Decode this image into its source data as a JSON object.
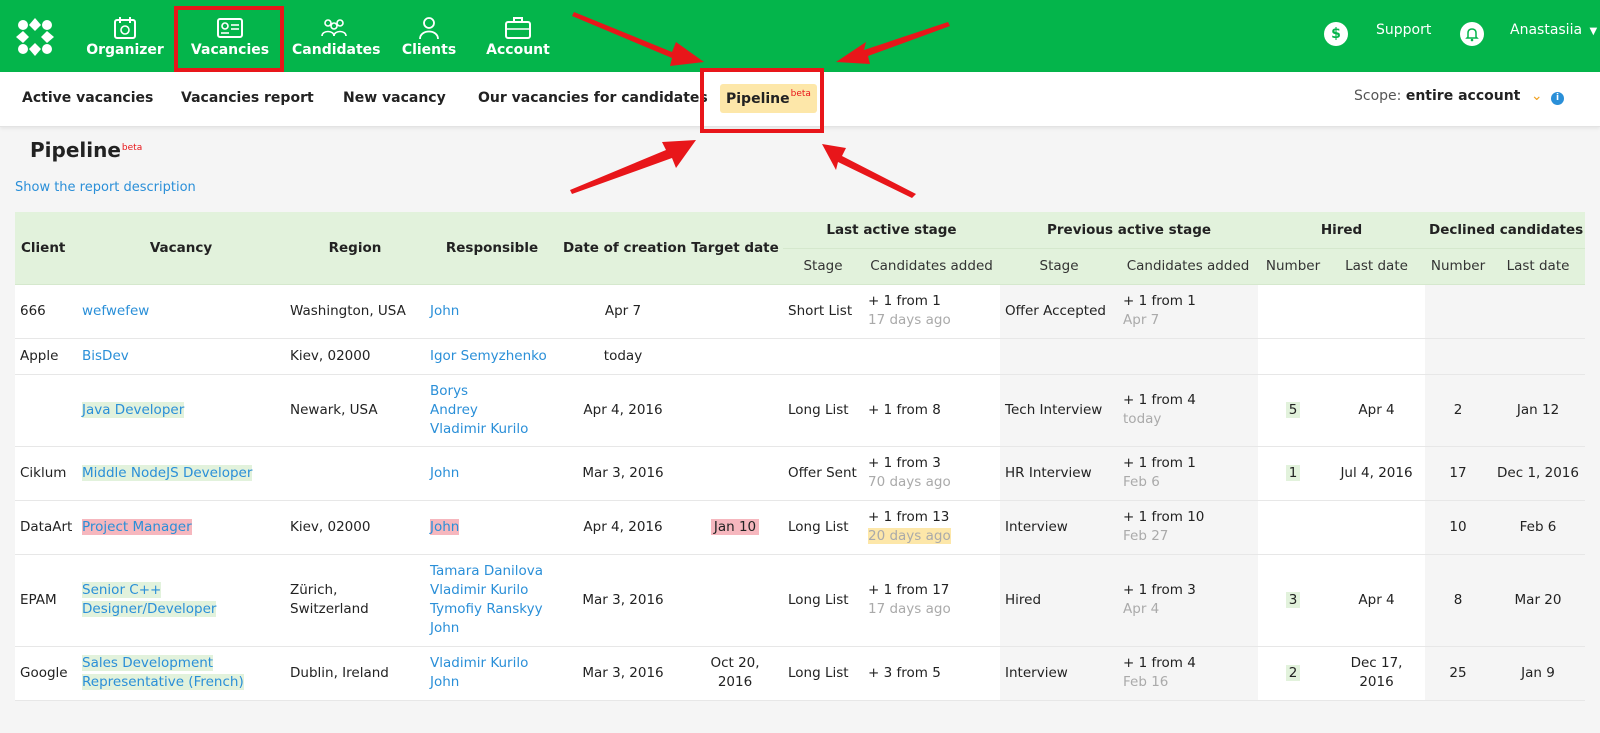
{
  "topnav": {
    "items": [
      {
        "label": "Organizer",
        "icon": "organizer-icon"
      },
      {
        "label": "Vacancies",
        "icon": "vacancy-card-icon"
      },
      {
        "label": "Candidates",
        "icon": "people-icon"
      },
      {
        "label": "Clients",
        "icon": "person-icon"
      },
      {
        "label": "Account",
        "icon": "briefcase-icon"
      }
    ],
    "dollar_glyph": "$",
    "support": "Support",
    "user": "Anastasiia"
  },
  "subnav": {
    "items": [
      "Active vacancies",
      "Vacancies report",
      "New vacancy",
      "Our vacancies for candidates"
    ],
    "pipeline": "Pipeline",
    "beta": "beta",
    "scope_label": "Scope:",
    "scope_value": "entire account"
  },
  "page": {
    "title": "Pipeline",
    "beta": "beta",
    "description_link": "Show the report description"
  },
  "table": {
    "headers": {
      "client": "Client",
      "vacancy": "Vacancy",
      "region": "Region",
      "responsible": "Responsible",
      "date_of_creation": "Date of creation",
      "target_date": "Target date",
      "last_active_stage": "Last active stage",
      "previous_active_stage": "Previous active stage",
      "hired": "Hired",
      "declined": "Declined candidates",
      "stage": "Stage",
      "candidates_added": "Candidates added",
      "number": "Number",
      "last_date": "Last date"
    },
    "rows": [
      {
        "client": "666",
        "vacancy": "wefwefew",
        "region": "Washington, USA",
        "responsible": [
          "John"
        ],
        "created": "Apr 7",
        "target": "",
        "last_stage": "Short List",
        "last_added": "+ 1 from 1",
        "last_ago": "17 days ago",
        "prev_stage": "Offer Accepted",
        "prev_added": "+ 1 from 1",
        "prev_ago": "Apr 7",
        "hired_num": "",
        "hired_date": "",
        "declined_num": "",
        "declined_date": ""
      },
      {
        "client": "Apple",
        "vacancy": "BisDev",
        "region": "Kiev, 02000",
        "responsible": [
          "Igor Semyzhenko"
        ],
        "created": "today",
        "target": "",
        "last_stage": "",
        "last_added": "",
        "last_ago": "",
        "prev_stage": "",
        "prev_added": "",
        "prev_ago": "",
        "hired_num": "",
        "hired_date": "",
        "declined_num": "",
        "declined_date": ""
      },
      {
        "client": "",
        "vacancy": "Java Developer",
        "region": "Newark, USA",
        "responsible": [
          "Borys",
          "Andrey",
          "Vladimir Kurilo"
        ],
        "created": "Apr 4, 2016",
        "target": "",
        "last_stage": "Long List",
        "last_added": "+ 1 from 8",
        "last_ago": "",
        "prev_stage": "Tech Interview",
        "prev_added": "+ 1 from 4",
        "prev_ago": "today",
        "hired_num": "5",
        "hired_date": "Apr 4",
        "declined_num": "2",
        "declined_date": "Jan 12"
      },
      {
        "client": "Ciklum",
        "vacancy": "Middle NodeJS Developer",
        "region": "",
        "responsible": [
          "John"
        ],
        "created": "Mar 3, 2016",
        "target": "",
        "last_stage": "Offer Sent",
        "last_added": "+ 1 from 3",
        "last_ago": "70 days ago",
        "prev_stage": "HR Interview",
        "prev_added": "+ 1 from 1",
        "prev_ago": "Feb 6",
        "hired_num": "1",
        "hired_date": "Jul 4, 2016",
        "declined_num": "17",
        "declined_date": "Dec 1, 2016"
      },
      {
        "client": "DataArt",
        "vacancy": "Project Manager",
        "region": "Kiev, 02000",
        "responsible": [
          "John"
        ],
        "created": "Apr 4, 2016",
        "target": "Jan 10",
        "last_stage": "Long List",
        "last_added": "+ 1 from 13",
        "last_ago": "20 days ago",
        "prev_stage": "Interview",
        "prev_added": "+ 1 from 10",
        "prev_ago": "Feb 27",
        "hired_num": "",
        "hired_date": "",
        "declined_num": "10",
        "declined_date": "Feb 6"
      },
      {
        "client": "EPAM",
        "vacancy": "Senior C++ Designer/Developer",
        "region": "Zürich, Switzerland",
        "responsible": [
          "Tamara Danilova",
          "Vladimir Kurilo",
          "Tymofiy Ranskyy",
          "John"
        ],
        "created": "Mar 3, 2016",
        "target": "",
        "last_stage": "Long List",
        "last_added": "+ 1 from 17",
        "last_ago": "17 days ago",
        "prev_stage": "Hired",
        "prev_added": "+ 1 from 3",
        "prev_ago": "Apr 4",
        "hired_num": "3",
        "hired_date": "Apr 4",
        "declined_num": "8",
        "declined_date": "Mar 20"
      },
      {
        "client": "Google",
        "vacancy": "Sales Development Representative (French)",
        "region": "Dublin, Ireland",
        "responsible": [
          "Vladimir Kurilo",
          "John"
        ],
        "created": "Mar 3, 2016",
        "target": "Oct 20, 2016",
        "last_stage": "Long List",
        "last_added": "+ 3 from 5",
        "last_ago": "",
        "prev_stage": "Interview",
        "prev_added": "+ 1 from 4",
        "prev_ago": "Feb 16",
        "hired_num": "2",
        "hired_date": "Dec 17, 2016",
        "declined_num": "25",
        "declined_date": "Jan 9"
      }
    ]
  },
  "colors": {
    "brand_green": "#04b54b",
    "link_blue": "#2a8fd8",
    "annotation_red": "#e8161a",
    "header_green": "#e2f2dc",
    "highlight_yellow": "#fde7a9",
    "highlight_red": "#f6b7be"
  }
}
